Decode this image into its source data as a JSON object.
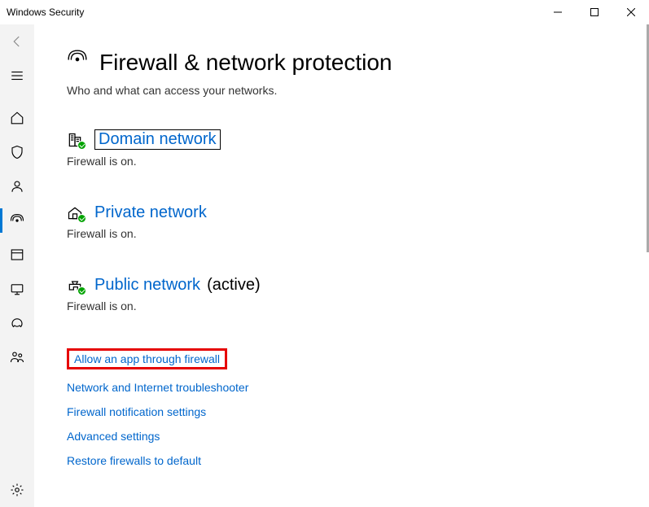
{
  "window": {
    "title": "Windows Security"
  },
  "page": {
    "title": "Firewall & network protection",
    "subtitle": "Who and what can access your networks."
  },
  "networks": {
    "domain": {
      "label": "Domain network",
      "status": "Firewall is on."
    },
    "private": {
      "label": "Private network",
      "status": "Firewall is on."
    },
    "public": {
      "label": "Public network",
      "active_tag": "(active)",
      "status": "Firewall is on."
    }
  },
  "links": {
    "allow_app": "Allow an app through firewall",
    "troubleshooter": "Network and Internet troubleshooter",
    "notifications": "Firewall notification settings",
    "advanced": "Advanced settings",
    "restore": "Restore firewalls to default"
  }
}
